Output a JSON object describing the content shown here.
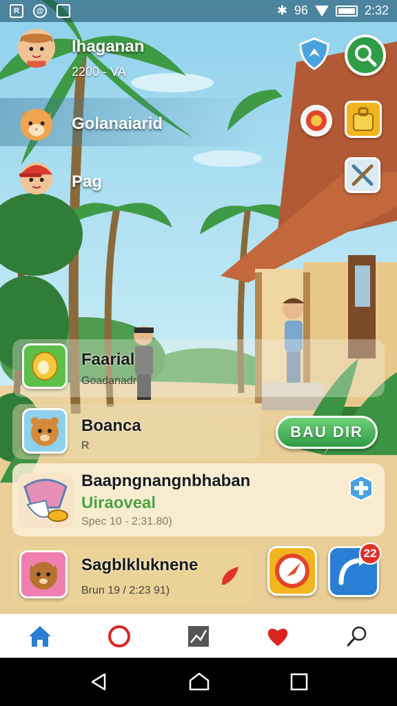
{
  "status_bar": {
    "signal_text": "96",
    "time": "2:32"
  },
  "players": [
    {
      "name": "Ihaganan",
      "sub": "2200 - VA",
      "avatar": "farmer-girl-avatar"
    },
    {
      "name": "Golanaiarid",
      "sub": "",
      "avatar": "cat-avatar"
    },
    {
      "name": "Pag",
      "sub": "",
      "avatar": "red-cap-boy-avatar"
    }
  ],
  "quests": [
    {
      "title": "Faarial",
      "sub": "Goadanadr",
      "icon": "golden-seed-icon"
    },
    {
      "title": "Boanca",
      "sub": "R",
      "icon": "hamster-icon"
    },
    {
      "title": "Baapngnangnbhaban",
      "subtitle": "Uiraoveal",
      "sub": "Spec 10 - 2:31.80)",
      "icon": "shell-treasure-icon"
    },
    {
      "title": "Sagblkluknene",
      "sub": "Brun 19 / 2:23 91)",
      "icon": "squirrel-icon"
    }
  ],
  "raid_button_label": "BAU DIR",
  "badge_count": "22",
  "colors": {
    "accent_green": "#2f9d46",
    "badge_red": "#e0302a",
    "tab_blue": "#2a7fd4",
    "tab_red": "#d9241f"
  },
  "tabs": [
    "home-icon",
    "ring-icon",
    "chart-icon",
    "heart-icon",
    "search-icon"
  ]
}
